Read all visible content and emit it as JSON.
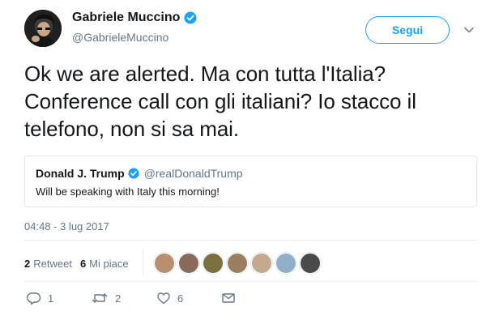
{
  "user": {
    "name": "Gabriele Muccino",
    "handle": "@GabrieleMuccino",
    "verified": true,
    "follow_label": "Segui"
  },
  "tweet": {
    "text": "Ok we are alerted. Ma con tutta l'Italia? Conference call con gli italiani? Io stacco il telefono, non si sa mai.",
    "timestamp": "04:48 - 3 lug 2017"
  },
  "quoted": {
    "name": "Donald J. Trump",
    "handle": "@realDonaldTrump",
    "verified": true,
    "text": "Will be speaking with Italy this morning!"
  },
  "stats": {
    "retweets_count": "2",
    "retweets_label": "Retweet",
    "likes_count": "6",
    "likes_label": "Mi piace"
  },
  "likers": [
    {
      "color": "#b89070"
    },
    {
      "color": "#8a6a5a"
    },
    {
      "color": "#7a7040"
    },
    {
      "color": "#9a8060"
    },
    {
      "color": "#c4a890"
    },
    {
      "color": "#8fb0c8"
    },
    {
      "color": "#4a4a4a"
    }
  ],
  "actions": {
    "reply_count": "1",
    "retweet_count": "2",
    "like_count": "6"
  },
  "colors": {
    "accent": "#1da1f2",
    "secondary_text": "#657786",
    "border": "#e1e8ed"
  }
}
